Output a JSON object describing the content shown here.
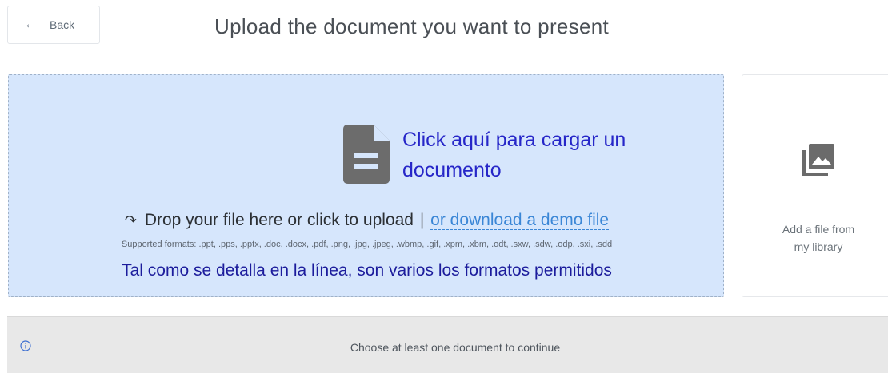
{
  "header": {
    "back_label": "Back",
    "title": "Upload the document you want to present"
  },
  "dropzone": {
    "annotation_top": "Click aquí para cargar un documento",
    "drop_text": "Drop your file here or click to upload",
    "separator": "|",
    "demo_link": "or download a demo file",
    "formats": "Supported formats: .ppt, .pps, .pptx, .doc, .docx, .pdf, .png, .jpg, .jpeg, .wbmp, .gif, .xpm, .xbm, .odt, .sxw, .sdw, .odp, .sxi, .sdd",
    "annotation_bottom": "Tal como se detalla en la línea, son varios los formatos permitidos"
  },
  "library": {
    "label_line1": "Add a file from",
    "label_line2": "my library"
  },
  "footer": {
    "message": "Choose at least one document to continue"
  },
  "icons": {
    "back": "arrow-left-icon",
    "document": "document-icon",
    "refresh": "refresh-icon",
    "library": "image-library-icon",
    "info": "info-icon"
  },
  "colors": {
    "dropzone_bg": "#d6e6fc",
    "annotation": "#2626c8",
    "link": "#3a86d6",
    "footer_bg": "#e8e8e8"
  }
}
